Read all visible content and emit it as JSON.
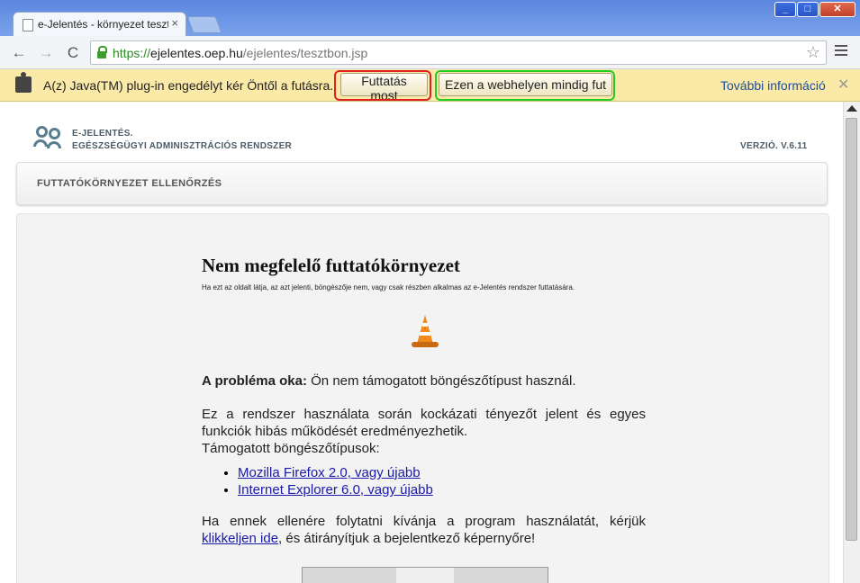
{
  "window": {
    "tab_title": "e-Jelentés - környezet tesztb",
    "tab_close": "×",
    "min": "_",
    "max": "□",
    "close": "✕"
  },
  "toolbar": {
    "back": "←",
    "forward": "→",
    "reload": "C",
    "url_scheme": "https://",
    "url_host": "ejelentes.oep.hu",
    "url_path": "/ejelentes/tesztbon.jsp",
    "star": "☆"
  },
  "infobar": {
    "message": "A(z) Java(TM) plug-in engedélyt kér Öntől a futásra.",
    "run_now": "Futtatás most",
    "always_run": "Ezen a webhelyen mindig fut",
    "more_info": "További információ",
    "close": "✕"
  },
  "header": {
    "brand_line1": "E-JELENTÉS.",
    "brand_line2": "EGÉSZSÉGÜGYI ADMINISZTRÁCIÓS RENDSZER",
    "version": "VERZIÓ. V.6.11"
  },
  "section": {
    "title": "FUTTATÓKÖRNYEZET ELLENŐRZÉS"
  },
  "main": {
    "heading": "Nem megfelelő futtatókörnyezet",
    "intro": "Ha ezt az oldalt látja, az azt jelenti, böngészője nem, vagy csak részben alkalmas az e-Jelentés rendszer futtatására.",
    "problem_label": "A probléma oka:",
    "problem_text": " Ön nem támogatott böngészőtípust használ.",
    "warning": "Ez a rendszer használata során kockázati tényezőt jelent és egyes funkciók hibás működését eredményezhetik.",
    "supported_label": "Támogatott böngészőtípusok:",
    "browsers": [
      "Mozilla Firefox 2.0, vagy újabb",
      "Internet Explorer 6.0, vagy újabb"
    ],
    "continue_text": "Ha ennek ellenére folytatni kívánja a program használatát, kérjük ",
    "continue_link": "klikkeljen ide",
    "continue_rest": ", és átirányítjuk a bejelentkező képernyőre!"
  }
}
